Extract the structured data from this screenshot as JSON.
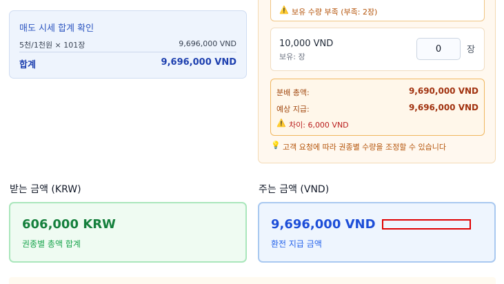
{
  "confirm": {
    "title": "매도 시세 합계 확인",
    "row_label": "5천/1천원 × 101장",
    "row_value": "9,696,000 VND",
    "total_label": "합계",
    "total_value": "9,696,000 VND"
  },
  "panel": {
    "warning_text": "보유 수량 부족 (부족: 2장)",
    "denomination": {
      "name": "10,000 VND",
      "holding": "보유: 장",
      "quantity": "0",
      "unit": "장"
    },
    "summary": {
      "allocated_label": "분배 총액:",
      "allocated_value": "9,690,000 VND",
      "expected_label": "예상 지급:",
      "expected_value": "9,696,000 VND",
      "difference_text": "차이: 6,000 VND"
    },
    "hint_text": "고객 요청에 따라 권종별 수량을 조정할 수 있습니다"
  },
  "receive": {
    "heading": "받는 금액 (KRW)",
    "amount": "606,000 KRW",
    "caption": "권종별 총액 합계"
  },
  "give": {
    "heading": "주는 금액 (VND)",
    "amount": "9,696,000 VND",
    "caption": "환전 지급 금액"
  },
  "icons": {
    "warning": "warning-icon",
    "lightbulb": "lightbulb-icon"
  },
  "colors": {
    "accent_blue": "#1d4ed8",
    "accent_green": "#15803d",
    "warning_orange": "#b45309",
    "highlight_red": "#e00000"
  }
}
